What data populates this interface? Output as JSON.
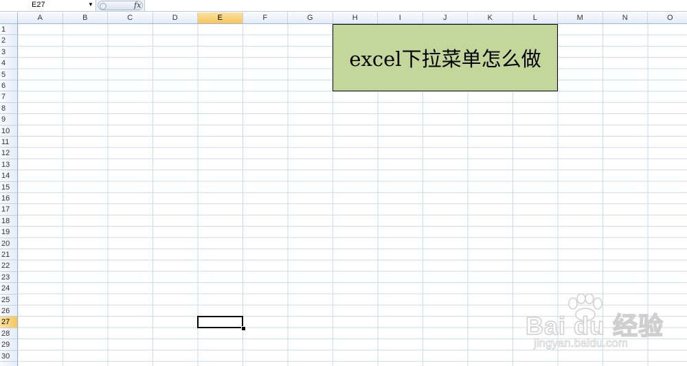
{
  "formula_bar": {
    "name_box": "E27",
    "fx_label": "fx",
    "formula": ""
  },
  "columns": [
    "A",
    "B",
    "C",
    "D",
    "E",
    "F",
    "G",
    "H",
    "I",
    "J",
    "K",
    "L",
    "M",
    "N",
    "O"
  ],
  "selected_column": "E",
  "rows": [
    "1",
    "2",
    "3",
    "4",
    "5",
    "6",
    "7",
    "8",
    "9",
    "10",
    "11",
    "12",
    "13",
    "14",
    "15",
    "16",
    "17",
    "18",
    "19",
    "20",
    "21",
    "22",
    "23",
    "24",
    "25",
    "26",
    "27",
    "28",
    "29",
    "30"
  ],
  "selected_row": "27",
  "banner": {
    "text": "excel下拉菜单怎么做",
    "fill_color": "#c4d79b"
  },
  "watermark": {
    "brand": "Bai du 经验",
    "url": "jingyan.baidu.com"
  }
}
